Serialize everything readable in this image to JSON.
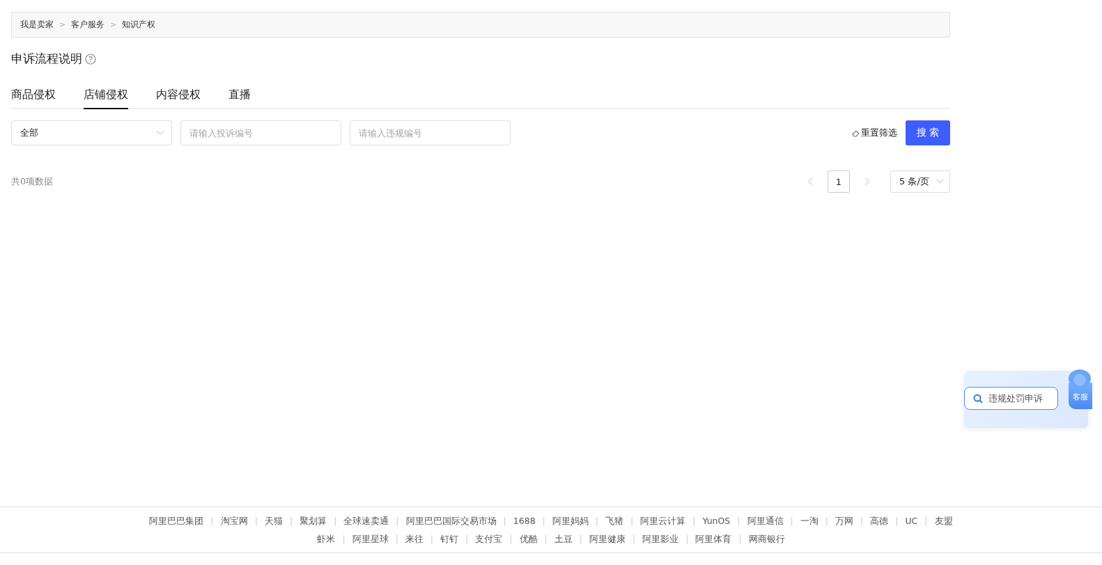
{
  "breadcrumb": [
    "我是卖家",
    "客户服务",
    "知识产权"
  ],
  "breadcrumb_separator": ">",
  "title": "申诉流程说明",
  "tabs": [
    {
      "label": "商品侵权",
      "selected": false
    },
    {
      "label": "店铺侵权",
      "selected": true
    },
    {
      "label": "内容侵权",
      "selected": false
    },
    {
      "label": "直播",
      "selected": false
    }
  ],
  "filters": {
    "select_value": "全部",
    "complaint_placeholder": "请输入投诉编号",
    "violation_placeholder": "请输入违规编号",
    "reset": "重置筛选",
    "search": "搜 索"
  },
  "summary": "共0项数据",
  "pagination": {
    "pages": [
      {
        "label": "1",
        "selected": true
      }
    ],
    "page_size": "5 条/页"
  },
  "widget": {
    "search": "违规处罚申诉",
    "service": "客服"
  },
  "footer": {
    "first_line": [
      "阿里巴巴集团",
      "淘宝网",
      "天猫",
      "聚划算",
      "全球速卖通",
      "阿里巴巴国际交易市场",
      "1688",
      "阿里妈妈",
      "飞猪",
      "阿里云计算",
      "YunOS",
      "阿里通信",
      "一淘",
      "万网",
      "高德",
      "UC",
      "友盟"
    ],
    "second_line": [
      "虾米",
      "阿里星球",
      "来往",
      "钉钉",
      "支付宝",
      "优酷",
      "土豆",
      "阿里健康",
      "阿里影业",
      "阿里体育",
      "网商银行"
    ],
    "separator": "|"
  }
}
